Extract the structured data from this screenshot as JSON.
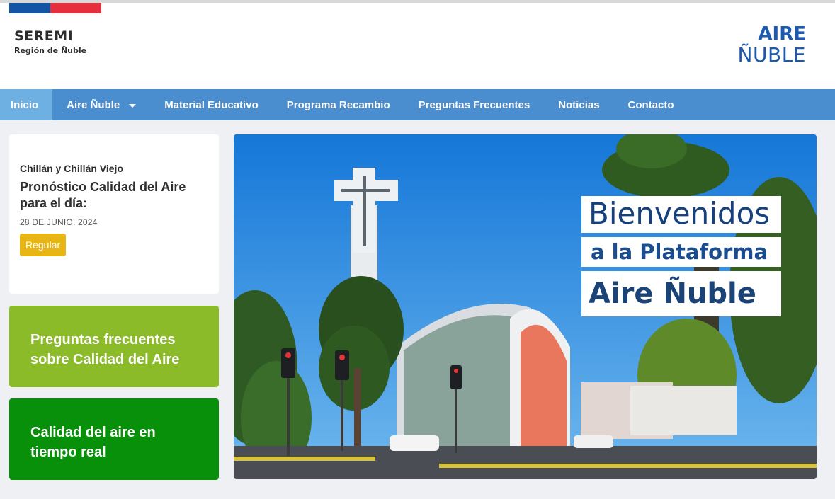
{
  "header": {
    "logo_left_line1": "SEREMI",
    "logo_left_line2": "Región de Ñuble",
    "logo_right_line1": "AIRE",
    "logo_right_line2": "ÑUBLE"
  },
  "nav": {
    "items": [
      {
        "label": "Inicio",
        "active": true
      },
      {
        "label": "Aire Ñuble",
        "has_dropdown": true
      },
      {
        "label": "Material Educativo"
      },
      {
        "label": "Programa Recambio"
      },
      {
        "label": "Preguntas Frecuentes"
      },
      {
        "label": "Noticias"
      },
      {
        "label": "Contacto"
      }
    ]
  },
  "forecast": {
    "location": "Chillán y Chillán Viejo",
    "title": "Pronóstico Calidad del Aire para el día:",
    "date": "28 DE JUNIO, 2024",
    "status": "Regular",
    "status_color": "#e7b615"
  },
  "cards": {
    "faq": "Preguntas frecuentes sobre Calidad del Aire",
    "realtime": "Calidad del aire en tiempo real"
  },
  "hero": {
    "line1": "Bienvenidos",
    "line2": "a la Plataforma",
    "line3": "Aire Ñuble"
  },
  "colors": {
    "nav": "#4a8ed0",
    "nav_active": "#6fb0e3",
    "faq_card": "#8cbb2a",
    "realtime_card": "#08900a",
    "brand_blue": "#1c59b0"
  }
}
